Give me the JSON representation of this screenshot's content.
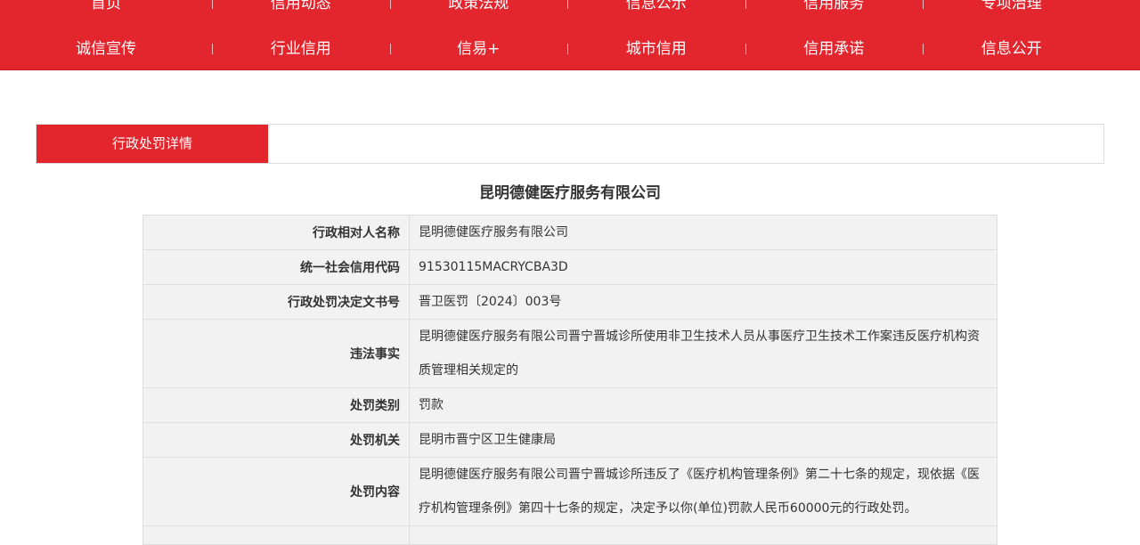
{
  "nav": {
    "row1": [
      "首页",
      "信用动态",
      "政策法规",
      "信息公示",
      "信用服务",
      "专项治理"
    ],
    "row2": [
      "诚信宣传",
      "行业信用",
      "信易+",
      "城市信用",
      "信用承诺",
      "信息公开"
    ]
  },
  "tab": {
    "active_label": "行政处罚详情"
  },
  "detail": {
    "title": "昆明德健医疗服务有限公司",
    "rows": [
      {
        "label": "行政相对人名称",
        "value": "昆明德健医疗服务有限公司"
      },
      {
        "label": "统一社会信用代码",
        "value": "91530115MACRYCBA3D"
      },
      {
        "label": "行政处罚决定文书号",
        "value": "晋卫医罚〔2024〕003号"
      },
      {
        "label": "违法事实",
        "value": "昆明德健医疗服务有限公司晋宁晋城诊所使用非卫生技术人员从事医疗卫生技术工作案违反医疗机构资质管理相关规定的"
      },
      {
        "label": "处罚类别",
        "value": "罚款"
      },
      {
        "label": "处罚机关",
        "value": "昆明市晋宁区卫生健康局"
      },
      {
        "label": "处罚内容",
        "value": "昆明德健医疗服务有限公司晋宁晋城诊所违反了《医疗机构管理条例》第二十七条的规定，现依据《医疗机构管理条例》第四十七条的规定，决定予以你(单位)罚款人民币60000元的行政处罚。"
      }
    ]
  }
}
